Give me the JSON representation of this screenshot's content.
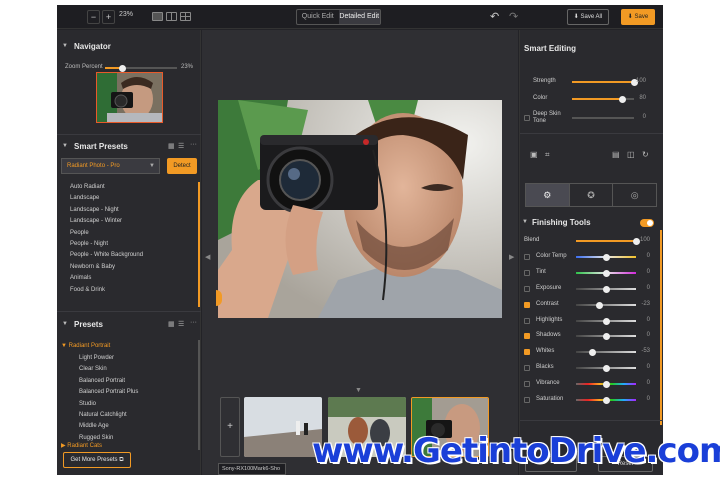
{
  "topbar": {
    "zoom_out": "−",
    "zoom_in": "+",
    "zoom_percent": "23%",
    "modes": [
      "Quick Edit",
      "Detailed Edit"
    ],
    "active_mode": "Detailed Edit",
    "undo": "↶",
    "redo": "↷",
    "save_all_label": "Save All",
    "save_label": "Save"
  },
  "navigator": {
    "title": "Navigator",
    "zoom_label": "Zoom Percent",
    "zoom_value": "23%",
    "zoom_fraction": 0.23
  },
  "smart_presets": {
    "title": "Smart Presets",
    "selected": "Radiant Photo - Pro",
    "detect_label": "Detect",
    "items": [
      "Auto Radiant",
      "Landscape",
      "Landscape - Night",
      "Landscape - Winter",
      "People",
      "People - Night",
      "People - White Background",
      "Newborn & Baby",
      "Animals",
      "Food & Drink"
    ]
  },
  "presets": {
    "title": "Presets",
    "group1": "Radiant Portrait",
    "items": [
      "Light Powder",
      "Clear Skin",
      "Balanced Portrait",
      "Balanced Portrait Plus",
      "Studio",
      "Natural Catchlight",
      "Middle Age",
      "Rugged Skin"
    ],
    "group2": "Radiant Cats",
    "more_label": "Get More Presets"
  },
  "filmstrip": {
    "add_label": "+",
    "camera_label": "Sony-RX100Mark6-Sho"
  },
  "smart_editing": {
    "title": "Smart Editing",
    "sliders": [
      {
        "label": "Strength",
        "value": "100",
        "fraction": 1.0
      },
      {
        "label": "Color",
        "value": "80",
        "fraction": 0.8
      },
      {
        "label": "Deep Skin Tone",
        "value": "0",
        "fraction": 0.0
      }
    ]
  },
  "finishing_tools": {
    "title": "Finishing Tools",
    "enabled": true,
    "sliders": [
      {
        "label": "Blend",
        "value": "100",
        "checked": false,
        "fraction": 1.0,
        "kind": "orange"
      },
      {
        "label": "Color Temp",
        "value": "0",
        "checked": false,
        "fraction": 0.5,
        "kind": "temp"
      },
      {
        "label": "Tint",
        "value": "0",
        "checked": false,
        "fraction": 0.5,
        "kind": "tint"
      },
      {
        "label": "Exposure",
        "value": "0",
        "checked": false,
        "fraction": 0.5,
        "kind": "gray"
      },
      {
        "label": "Contrast",
        "value": "-23",
        "checked": true,
        "fraction": 0.38,
        "kind": "gray"
      },
      {
        "label": "Highlights",
        "value": "0",
        "checked": false,
        "fraction": 0.5,
        "kind": "gray"
      },
      {
        "label": "Shadows",
        "value": "0",
        "checked": true,
        "fraction": 0.5,
        "kind": "gray"
      },
      {
        "label": "Whites",
        "value": "-53",
        "checked": true,
        "fraction": 0.27,
        "kind": "gray"
      },
      {
        "label": "Blacks",
        "value": "0",
        "checked": false,
        "fraction": 0.5,
        "kind": "gray"
      },
      {
        "label": "Vibrance",
        "value": "0",
        "checked": false,
        "fraction": 0.5,
        "kind": "rainbow"
      },
      {
        "label": "Saturation",
        "value": "0",
        "checked": false,
        "fraction": 0.5,
        "kind": "rainbow"
      }
    ],
    "reset_label": "Reset"
  },
  "watermark": "www.GetintoDrive.com",
  "colors": {
    "accent": "#f29a24",
    "bg": "#232327",
    "panel": "#2a2a2e",
    "watermark": "#1a3fd8"
  }
}
